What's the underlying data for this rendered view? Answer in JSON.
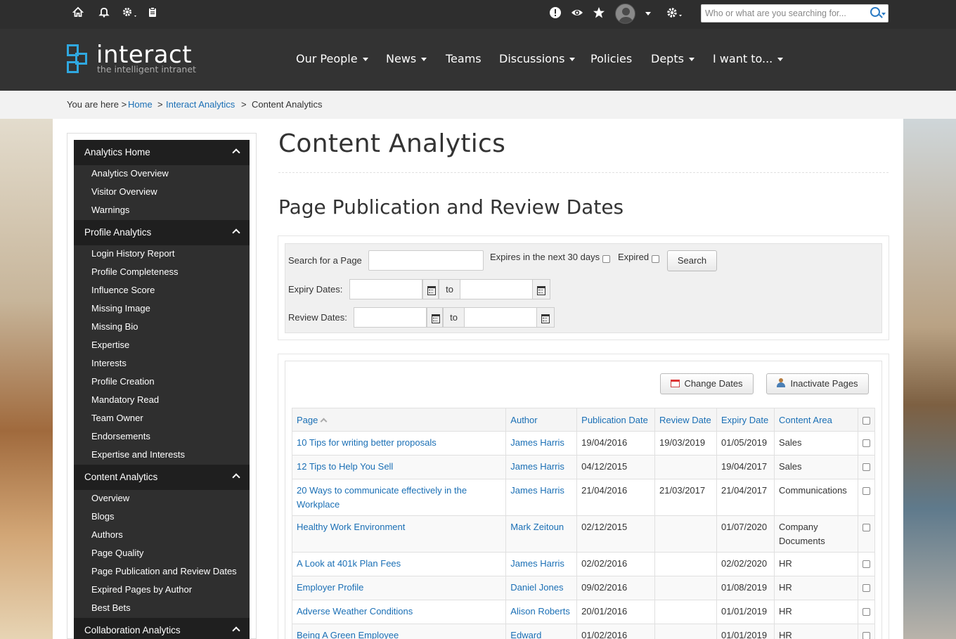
{
  "topbar": {
    "icons": [
      "home-icon",
      "bell-icon",
      "settings-dropdown-icon",
      "clipboard-icon",
      "alert-icon",
      "eye-icon",
      "star-icon",
      "avatar",
      "gear-dropdown-icon"
    ],
    "search_placeholder": "Who or what are you searching for..."
  },
  "header": {
    "logo_text": "interact",
    "logo_tagline": "the intelligent intranet",
    "nav": [
      {
        "label": "Our People",
        "dropdown": true
      },
      {
        "label": "News",
        "dropdown": true
      },
      {
        "label": "Teams",
        "dropdown": false
      },
      {
        "label": "Discussions",
        "dropdown": true
      },
      {
        "label": "Policies",
        "dropdown": false
      },
      {
        "label": "Depts",
        "dropdown": true
      },
      {
        "label": "I want to...",
        "dropdown": true
      }
    ]
  },
  "breadcrumb": {
    "prefix": "You are here >",
    "home": "Home",
    "sep1": ">",
    "analytics": "Interact Analytics",
    "sep2": ">",
    "current": "Content Analytics"
  },
  "sidebar": {
    "sections": [
      {
        "title": "Analytics Home",
        "items": [
          "Analytics Overview",
          "Visitor Overview",
          "Warnings"
        ]
      },
      {
        "title": "Profile Analytics",
        "items": [
          "Login History Report",
          "Profile Completeness",
          "Influence Score",
          "Missing Image",
          "Missing Bio",
          "Expertise",
          "Interests",
          "Profile Creation",
          "Mandatory Read",
          "Team Owner",
          "Endorsements",
          "Expertise and Interests"
        ]
      },
      {
        "title": "Content Analytics",
        "items": [
          "Overview",
          "Blogs",
          "Authors",
          "Page Quality",
          "Page Publication and Review Dates",
          "Expired Pages by Author",
          "Best Bets"
        ]
      },
      {
        "title": "Collaboration Analytics",
        "items": []
      }
    ]
  },
  "main": {
    "title": "Content Analytics",
    "subtitle": "Page Publication and Review Dates",
    "filters": {
      "search_label": "Search for a Page",
      "search_value": "",
      "expires_label": "Expires in the next 30 days",
      "expired_label": "Expired",
      "search_button": "Search",
      "expiry_label": "Expiry Dates:",
      "review_label": "Review Dates:",
      "to": "to"
    },
    "actions": {
      "change_dates": "Change Dates",
      "inactivate_pages": "Inactivate Pages"
    },
    "table": {
      "columns": [
        "Page",
        "Author",
        "Publication Date",
        "Review Date",
        "Expiry Date",
        "Content Area"
      ],
      "rows": [
        {
          "page": "10 Tips for writing better proposals",
          "author": "James Harris",
          "pub": "19/04/2016",
          "review": "19/03/2019",
          "expiry": "01/05/2019",
          "area": "Sales"
        },
        {
          "page": "12 Tips to Help You Sell",
          "author": "James Harris",
          "pub": "04/12/2015",
          "review": "",
          "expiry": "19/04/2017",
          "area": "Sales"
        },
        {
          "page": "20 Ways to communicate effectively in the Workplace",
          "author": "James Harris",
          "pub": "21/04/2016",
          "review": "21/03/2017",
          "expiry": "21/04/2017",
          "area": "Communications"
        },
        {
          "page": "Healthy Work Environment",
          "author": "Mark Zeitoun",
          "pub": "02/12/2015",
          "review": "",
          "expiry": "01/07/2020",
          "area": "Company Documents"
        },
        {
          "page": "A Look at 401k Plan Fees",
          "author": "James Harris",
          "pub": "02/02/2016",
          "review": "",
          "expiry": "02/02/2020",
          "area": "HR"
        },
        {
          "page": "Employer Profile",
          "author": "Daniel Jones",
          "pub": "09/02/2016",
          "review": "",
          "expiry": "01/08/2019",
          "area": "HR"
        },
        {
          "page": "Adverse Weather Conditions",
          "author": "Alison Roberts",
          "pub": "20/01/2016",
          "review": "",
          "expiry": "01/01/2019",
          "area": "HR"
        },
        {
          "page": "Being A Green Employee",
          "author": "Edward Xanthos",
          "pub": "01/02/2016",
          "review": "",
          "expiry": "01/01/2019",
          "area": "HR"
        }
      ]
    }
  },
  "colors": {
    "topbar": "#2e2e2e",
    "header": "#333333",
    "logo_accent": "#2fa8e0",
    "link": "#1a6fb5",
    "sidebar": "#2f2f2f",
    "sidebar_header": "#1f1f1f"
  }
}
